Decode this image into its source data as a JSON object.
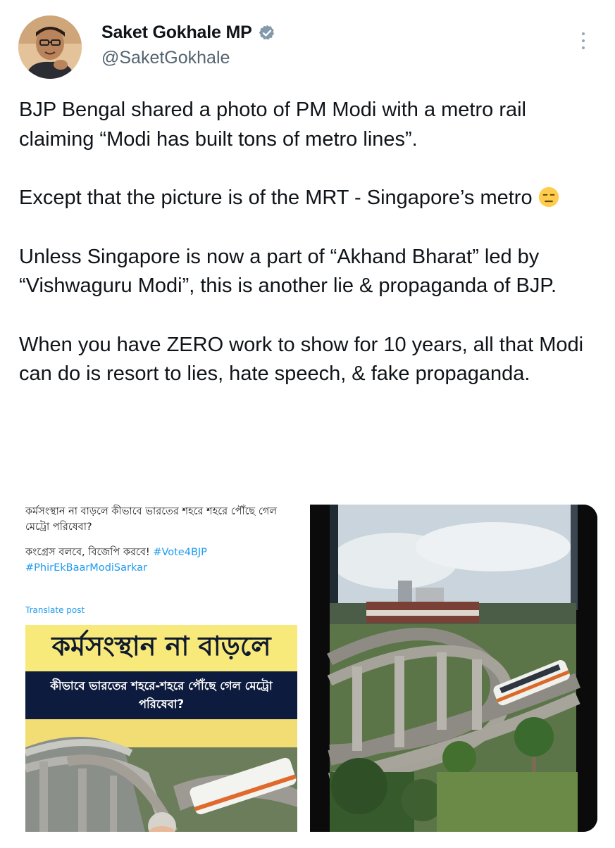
{
  "tweet": {
    "author_name": "Saket Gokhale MP",
    "handle": "@SaketGokhale",
    "paragraphs": [
      "BJP Bengal shared a photo of PM Modi with a metro rail claiming “Modi has built tons of metro lines”.",
      "Except that the picture is of the MRT - Singapore’s metro",
      "Unless Singapore is now a part of “Akhand Bharat” led by “Vishwaguru Modi”, this is another lie & propaganda of BJP.",
      "When you have ZERO work to show for 10 years, all that Modi can do is resort to lies, hate speech, & fake propaganda."
    ],
    "emoji": "expressionless-face"
  },
  "embedded_post": {
    "line1": "কর্মসংস্থান না বাড়লে কীভাবে ভারতের শহরে শহরে পৌঁছে গেল মেট্রো পরিষেবা?",
    "line2": "কংগ্রেস বলবে, বিজেপি করবে!",
    "hashtag1": "#Vote4BJP",
    "hashtag2": "#PhirEkBaarModiSarkar",
    "translate": "Translate post",
    "poster_headline": "কর্মসংস্থান না বাড়লে",
    "poster_subline": "কীভাবে ভারতের শহরে-শহরে পৌঁছে গেল মেট্রো পরিষেবা?"
  },
  "colors": {
    "link": "#1d9bf0",
    "verified": "#829aab",
    "poster_yellow": "#f7e97a",
    "poster_navy": "#0d1b3e"
  },
  "icons": {
    "verified": "verified-badge-icon",
    "more": "more-options-icon"
  }
}
